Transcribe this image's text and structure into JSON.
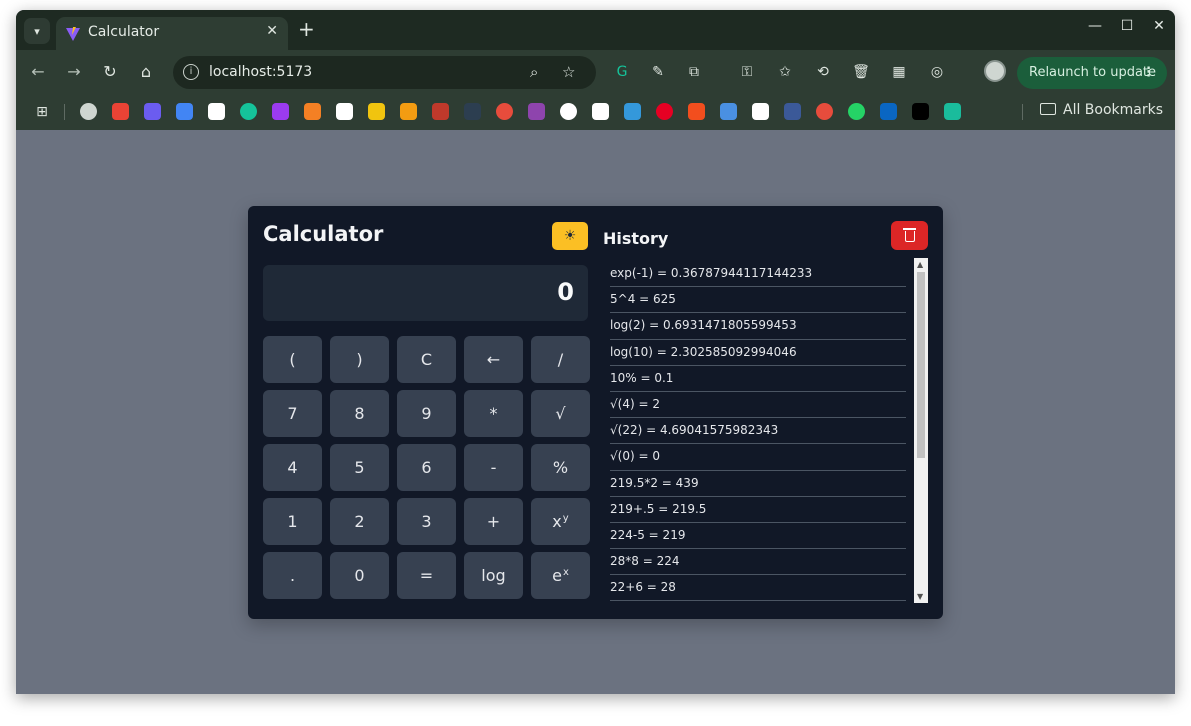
{
  "browser": {
    "tab": {
      "title": "Calculator",
      "close": "✕"
    },
    "new_tab": "+",
    "window_controls": {
      "minimize": "—",
      "maximize": "☐",
      "close": "✕"
    },
    "address": "localhost:5173",
    "relaunch_label": "Relaunch to update",
    "relaunch_menu": "⋮",
    "all_bookmarks": "All Bookmarks",
    "bookmarks": [
      {
        "icon": "avatar",
        "color": "#cfd6d1"
      },
      {
        "icon": "gmail",
        "color": "#ea4335"
      },
      {
        "icon": "blue-cube",
        "color": "#6b5cf0"
      },
      {
        "icon": "calendar-21",
        "color": "#4285f4"
      },
      {
        "icon": "notion",
        "color": "#ffffff"
      },
      {
        "icon": "grammarly",
        "color": "#15c39a"
      },
      {
        "icon": "purple-wave",
        "color": "#9b3bf0"
      },
      {
        "icon": "stackoverflow",
        "color": "#f48024"
      },
      {
        "icon": "github",
        "color": "#ffffff"
      },
      {
        "icon": "lightning",
        "color": "#f1c40f"
      },
      {
        "icon": "bar-chart",
        "color": "#f39c12"
      },
      {
        "icon": "cc",
        "color": "#c0392b"
      },
      {
        "icon": "person-dark",
        "color": "#2c3e50"
      },
      {
        "icon": "tuf",
        "color": "#e74c3c"
      },
      {
        "icon": "twitch-like",
        "color": "#8e44ad"
      },
      {
        "icon": "openai",
        "color": "#ffffff"
      },
      {
        "icon": "star-badge",
        "color": "#ffffff"
      },
      {
        "icon": "copilot",
        "color": "#3498db"
      },
      {
        "icon": "pinterest",
        "color": "#e60023"
      },
      {
        "icon": "figma",
        "color": "#f24e1e"
      },
      {
        "icon": "x-blue",
        "color": "#4a90e2"
      },
      {
        "icon": "w-dot",
        "color": "#ffffff"
      },
      {
        "icon": "mt",
        "color": "#3b5998"
      },
      {
        "icon": "sos",
        "color": "#e74c3c"
      },
      {
        "icon": "whatsapp",
        "color": "#25d366"
      },
      {
        "icon": "linkedin",
        "color": "#0a66c2"
      },
      {
        "icon": "x-twitter",
        "color": "#000000"
      },
      {
        "icon": "p-teal",
        "color": "#1abc9c"
      }
    ]
  },
  "calculator": {
    "title": "Calculator",
    "theme_icon": "☀",
    "display": "0",
    "keys": [
      {
        "label": "(",
        "sup": ""
      },
      {
        "label": ")",
        "sup": ""
      },
      {
        "label": "C",
        "sup": ""
      },
      {
        "label": "←",
        "sup": ""
      },
      {
        "label": "/",
        "sup": ""
      },
      {
        "label": "7",
        "sup": ""
      },
      {
        "label": "8",
        "sup": ""
      },
      {
        "label": "9",
        "sup": ""
      },
      {
        "label": "*",
        "sup": ""
      },
      {
        "label": "√",
        "sup": ""
      },
      {
        "label": "4",
        "sup": ""
      },
      {
        "label": "5",
        "sup": ""
      },
      {
        "label": "6",
        "sup": ""
      },
      {
        "label": "-",
        "sup": ""
      },
      {
        "label": "%",
        "sup": ""
      },
      {
        "label": "1",
        "sup": ""
      },
      {
        "label": "2",
        "sup": ""
      },
      {
        "label": "3",
        "sup": ""
      },
      {
        "label": "+",
        "sup": ""
      },
      {
        "label": "x",
        "sup": "y"
      },
      {
        "label": ".",
        "sup": ""
      },
      {
        "label": "0",
        "sup": ""
      },
      {
        "label": "=",
        "sup": ""
      },
      {
        "label": "log",
        "sup": ""
      },
      {
        "label": "e",
        "sup": "x"
      }
    ]
  },
  "history": {
    "title": "History",
    "items": [
      "exp(-1) = 0.36787944117144233",
      "5^4 = 625",
      "log(2) = 0.6931471805599453",
      "log(10) = 2.302585092994046",
      "10% = 0.1",
      "√(4) = 2",
      "√(22) = 4.69041575982343",
      "√(0) = 0",
      "219.5*2 = 439",
      "219+.5 = 219.5",
      "224-5 = 219",
      "28*8 = 224",
      "22+6 = 28"
    ]
  }
}
